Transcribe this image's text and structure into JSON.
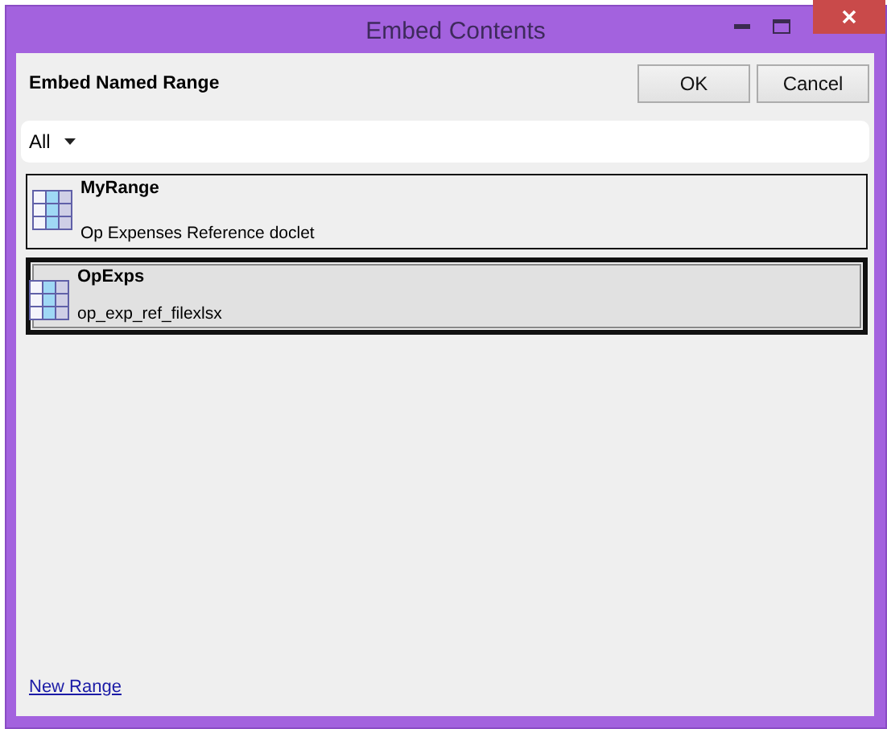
{
  "window": {
    "title": "Embed Contents"
  },
  "header": {
    "title": "Embed Named Range",
    "buttons": [
      "OK",
      "Cancel"
    ]
  },
  "filter": {
    "value": "All"
  },
  "ranges": [
    {
      "name": "MyRange",
      "source": "Op Expenses Reference doclet",
      "selected": false
    },
    {
      "name": "OpExps",
      "source": "op_exp_ref_filexlsx",
      "selected": true
    }
  ],
  "link": "New Range"
}
